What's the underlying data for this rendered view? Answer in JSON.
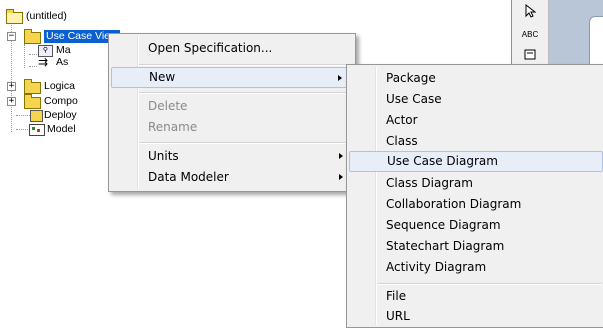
{
  "tree": {
    "root_label": "(untitled)",
    "items": [
      {
        "label": "Use Case View"
      },
      {
        "label": "Ma"
      },
      {
        "label": "As"
      },
      {
        "label": "Logica"
      },
      {
        "label": "Compo"
      },
      {
        "label": "Deploy"
      },
      {
        "label": "Model"
      }
    ]
  },
  "toolbar": {
    "tools": [
      {
        "icon": "arrow-pointer-icon",
        "label": ""
      },
      {
        "icon": "text-tool-icon",
        "label": "ABC"
      },
      {
        "icon": "note-icon",
        "label": ""
      }
    ]
  },
  "context_menu": {
    "items": [
      {
        "label": "Open Specification...",
        "disabled": false,
        "submenu": false
      },
      {
        "label": "New",
        "disabled": false,
        "submenu": true,
        "highlighted": true
      },
      {
        "label": "Delete",
        "disabled": true,
        "submenu": false
      },
      {
        "label": "Rename",
        "disabled": true,
        "submenu": false
      },
      {
        "label": "Units",
        "disabled": false,
        "submenu": true
      },
      {
        "label": "Data Modeler",
        "disabled": false,
        "submenu": true
      }
    ]
  },
  "new_submenu": {
    "items": [
      {
        "label": "Package"
      },
      {
        "label": "Use Case"
      },
      {
        "label": "Actor"
      },
      {
        "label": "Class"
      },
      {
        "label": "Use Case Diagram",
        "highlighted": true
      },
      {
        "label": "Class Diagram"
      },
      {
        "label": "Collaboration Diagram"
      },
      {
        "label": "Sequence Diagram"
      },
      {
        "label": "Statechart Diagram"
      },
      {
        "label": "Activity Diagram"
      },
      {
        "label": "File"
      },
      {
        "label": "URL"
      }
    ]
  },
  "colors": {
    "selection": "#0a5fd1",
    "menu_bg": "#f0f0f0",
    "menu_highlight": "#e8eef8",
    "folder": "#f5d44f"
  }
}
